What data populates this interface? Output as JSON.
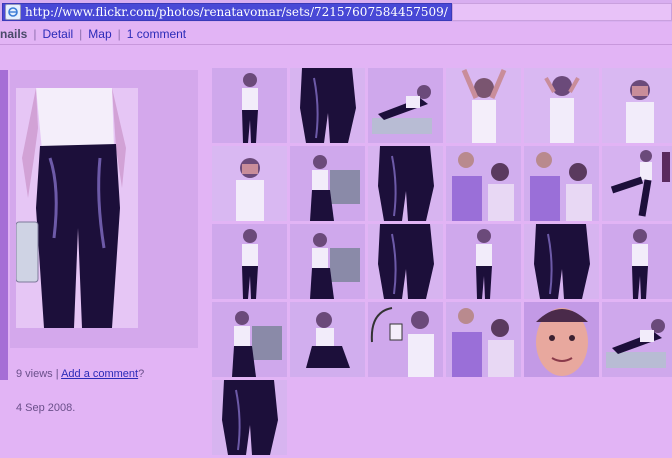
{
  "browser": {
    "url": "http://www.flickr.com/photos/renatavomar/sets/72157607584457509/"
  },
  "nav": {
    "current": "Thumbnails",
    "current_visible": "nails",
    "detail": "Detail",
    "map": "Map",
    "comment": "1 comment"
  },
  "photo_info": {
    "views": "9 views",
    "separator": "|",
    "add_comment": "Add a comment",
    "question": "?",
    "date": "4 Sep 2008."
  },
  "colors": {
    "accent_link": "#2b2bb8",
    "page_bg": "#e2b4f5",
    "url_highlight": "#4848d6"
  },
  "thumbnails": [
    {
      "scene": "stand"
    },
    {
      "scene": "pants"
    },
    {
      "scene": "lie"
    },
    {
      "scene": "arms-up"
    },
    {
      "scene": "hair"
    },
    {
      "scene": "hands-face"
    },
    {
      "scene": "hands-face"
    },
    {
      "scene": "sit"
    },
    {
      "scene": "pants"
    },
    {
      "scene": "duo"
    },
    {
      "scene": "duo"
    },
    {
      "scene": "kick"
    },
    {
      "scene": "stand"
    },
    {
      "scene": "sit"
    },
    {
      "scene": "pants"
    },
    {
      "scene": "stand"
    },
    {
      "scene": "pants"
    },
    {
      "scene": "stand"
    },
    {
      "scene": "sit"
    },
    {
      "scene": "crouch"
    },
    {
      "scene": "phone"
    },
    {
      "scene": "duo"
    },
    {
      "scene": "face"
    },
    {
      "scene": "lie"
    },
    {
      "scene": "pants"
    }
  ]
}
